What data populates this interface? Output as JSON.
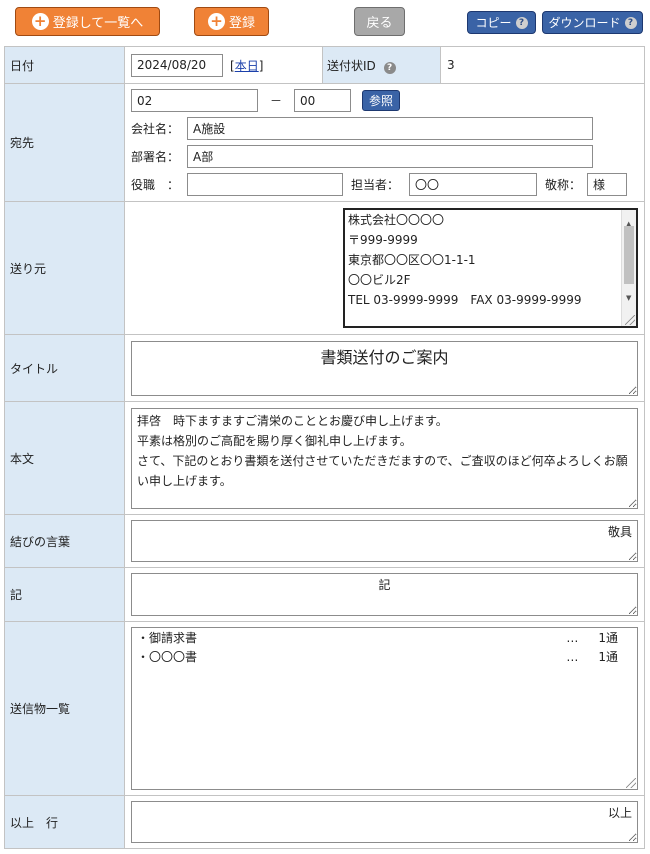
{
  "toolbar": {
    "register_list_label": "登録して一覧へ",
    "register_label": "登録",
    "back_label": "戻る",
    "copy_label": "コピー",
    "download_label": "ダウンロード"
  },
  "date": {
    "label": "日付",
    "value": "2024/08/20",
    "today_link": "本日"
  },
  "send_id": {
    "label": "送付状ID",
    "value": "3"
  },
  "recipient": {
    "label": "宛先",
    "zip1": "02",
    "zip_sep": "－",
    "zip2": "00",
    "lookup_button": "参照",
    "company_label": "会社名：",
    "company_value": "A施設",
    "dept_label": "部署名：",
    "dept_value": "A部",
    "position_label": "役職　：",
    "position_value": "",
    "person_label": "担当者：",
    "person_value": "〇〇",
    "honorific_label": "敬称：",
    "honorific_value": "様"
  },
  "sender": {
    "label": "送り元",
    "lines": [
      "株式会社〇〇〇〇",
      "〒999-9999",
      "東京都〇〇区〇〇1-1-1",
      "〇〇ビル2F",
      "TEL 03-9999-9999　FAX 03-9999-9999"
    ]
  },
  "title": {
    "label": "タイトル",
    "value": "書類送付のご案内"
  },
  "body": {
    "label": "本文",
    "value": "拝啓　時下ますますご清栄のこととお慶び申し上げます。\n平素は格別のご高配を賜り厚く御礼申し上げます。\nさて、下記のとおり書類を送付させていただきだますので、ご査収のほど何卒よろしくお願い申し上げます。"
  },
  "closing": {
    "label": "結びの言葉",
    "value": "敬具"
  },
  "ki": {
    "label": "記",
    "value": "記"
  },
  "items": {
    "label": "送信物一覧",
    "rows": [
      {
        "name": "・御請求書",
        "dots": "…",
        "qty": "1通"
      },
      {
        "name": "・〇〇〇書",
        "dots": "…",
        "qty": "1通"
      }
    ]
  },
  "end": {
    "label": "以上　行",
    "value": "以上"
  }
}
